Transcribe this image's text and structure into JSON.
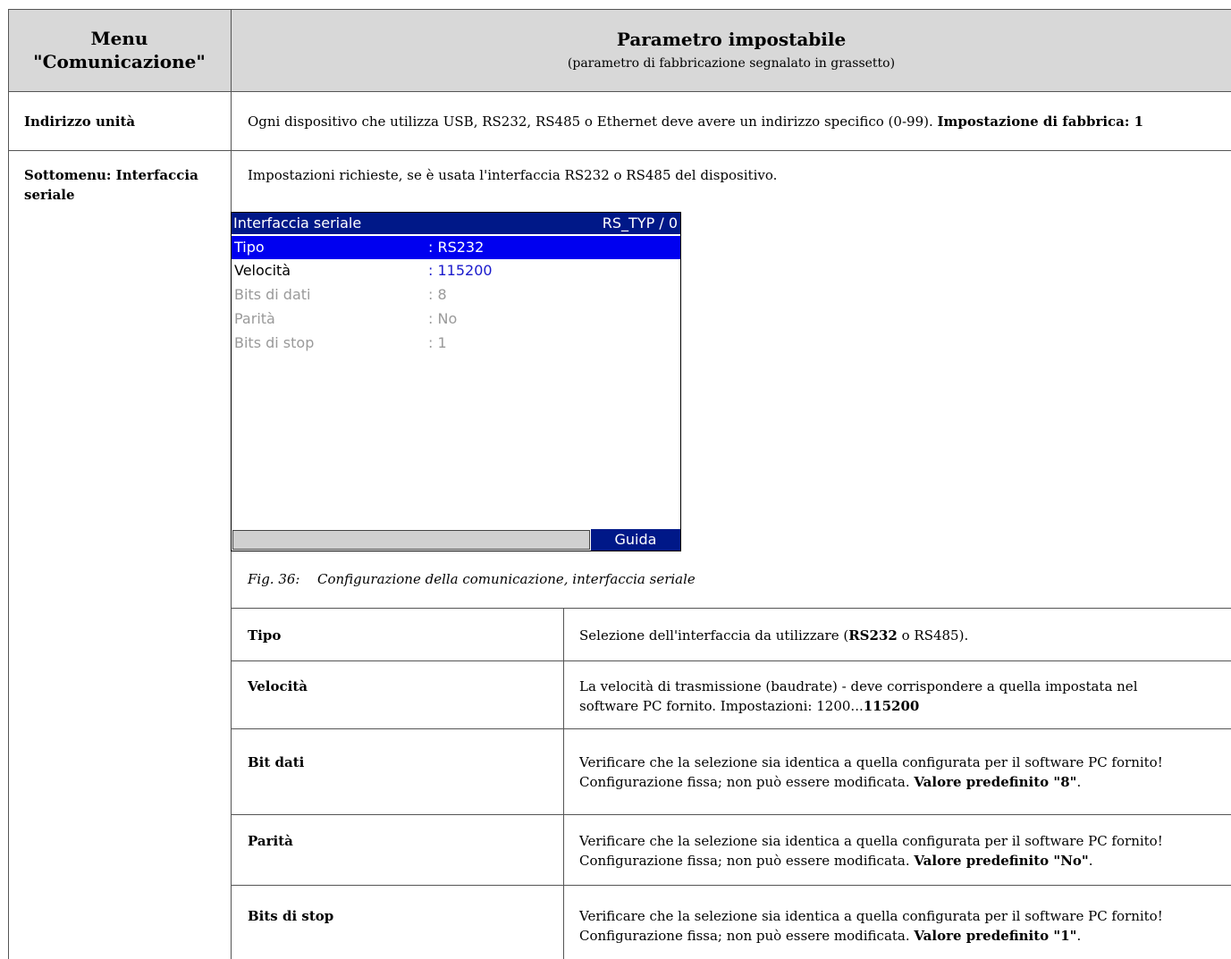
{
  "header": {
    "col1_line1": "Menu",
    "col1_line2": "\"Comunicazione\"",
    "col2_title": "Parametro impostabile",
    "col2_subtitle": "(parametro di fabbricazione segnalato in grassetto)"
  },
  "address_row": {
    "label": "Indirizzo unità",
    "text": "Ogni dispositivo che utilizza USB, RS232, RS485 o Ethernet deve avere un indirizzo specifico (0-99).",
    "default": "Impostazione di fabbrica: 1"
  },
  "serial_row": {
    "label_line1": "Sottomenu: Interfaccia",
    "label_line2": "seriale",
    "intro": "Impostazioni richieste, se è usata l'interfaccia RS232 o RS485 del dispositivo."
  },
  "screen": {
    "title": "Interfaccia seriale",
    "code": "RS_TYP / 0",
    "rows": [
      {
        "name": "Tipo",
        "value": ": RS232"
      },
      {
        "name": "Velocità",
        "value": ": 115200"
      },
      {
        "name": "Bits di dati",
        "value": ": 8"
      },
      {
        "name": "Parità",
        "value": ": No"
      },
      {
        "name": "Bits di stop",
        "value": ": 1"
      }
    ],
    "help_button": "Guida"
  },
  "caption": {
    "fig": "Fig. 36:",
    "text": "Configurazione della comunicazione, interfaccia seriale"
  },
  "params": [
    {
      "name": "Tipo",
      "line1_pre": "Selezione dell'interfaccia da utilizzare (",
      "line1_bold": "RS232",
      "line1_post": " o RS485)."
    },
    {
      "name": "Velocità",
      "line1": "La velocità di trasmissione (baudrate) - deve corrispondere a quella impostata nel",
      "line2_pre": "software PC fornito. Impostazioni: 1200...",
      "line2_bold": "115200"
    },
    {
      "name": "Bit dati",
      "line1": "Verificare che la selezione sia identica a quella configurata per il software PC fornito!",
      "line2_pre": "Configurazione fissa; non può essere modificata. ",
      "line2_bold": "Valore predefinito \"8\"",
      "line2_post": "."
    },
    {
      "name": "Parità",
      "line1": "Verificare che la selezione sia identica a quella configurata per il software PC fornito!",
      "line2_pre": "Configurazione fissa; non può essere modificata. ",
      "line2_bold": "Valore predefinito \"No\"",
      "line2_post": "."
    },
    {
      "name": "Bits di stop",
      "line1": "Verificare che la selezione sia identica a quella configurata per il software PC fornito!",
      "line2_pre": "Configurazione fissa; non può essere modificata. ",
      "line2_bold": "Valore predefinito \"1\"",
      "line2_post": "."
    }
  ]
}
